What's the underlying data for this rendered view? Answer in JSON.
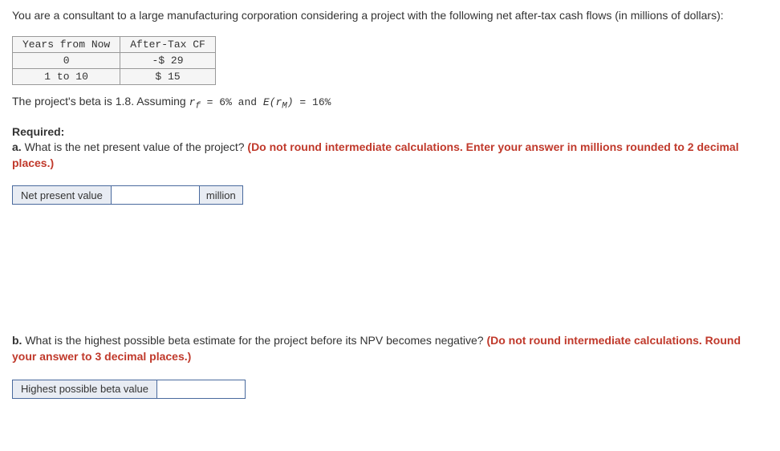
{
  "intro": "You are a consultant to a large manufacturing corporation considering a project with the following net after-tax cash flows (in millions of dollars):",
  "cf_table": {
    "headers": [
      "Years from Now",
      "After-Tax CF"
    ],
    "rows": [
      {
        "years": "0",
        "cf": "-$ 29"
      },
      {
        "years": "1 to 10",
        "cf": "$ 15"
      }
    ]
  },
  "assumption": {
    "prefix": "The project's beta is 1.8. Assuming ",
    "rf_symbol": "r",
    "rf_sub": "f",
    "rf_text": " = 6% and ",
    "erm_symbol": "E(r",
    "erm_sub": "M",
    "erm_close": ")",
    "erm_text": " = 16%"
  },
  "required_label": "Required:",
  "question_a": {
    "letter": "a.",
    "text": " What is the net present value of the project? ",
    "instruction": "(Do not round intermediate calculations. Enter your answer in millions rounded to 2 decimal places.)"
  },
  "answer_a": {
    "label": "Net present value",
    "unit": "million"
  },
  "question_b": {
    "letter": "b.",
    "text": " What is the highest possible beta estimate for the project before its NPV becomes negative? ",
    "instruction": "(Do not round intermediate calculations. Round your answer to 3 decimal places.)"
  },
  "answer_b": {
    "label": "Highest possible beta value"
  }
}
